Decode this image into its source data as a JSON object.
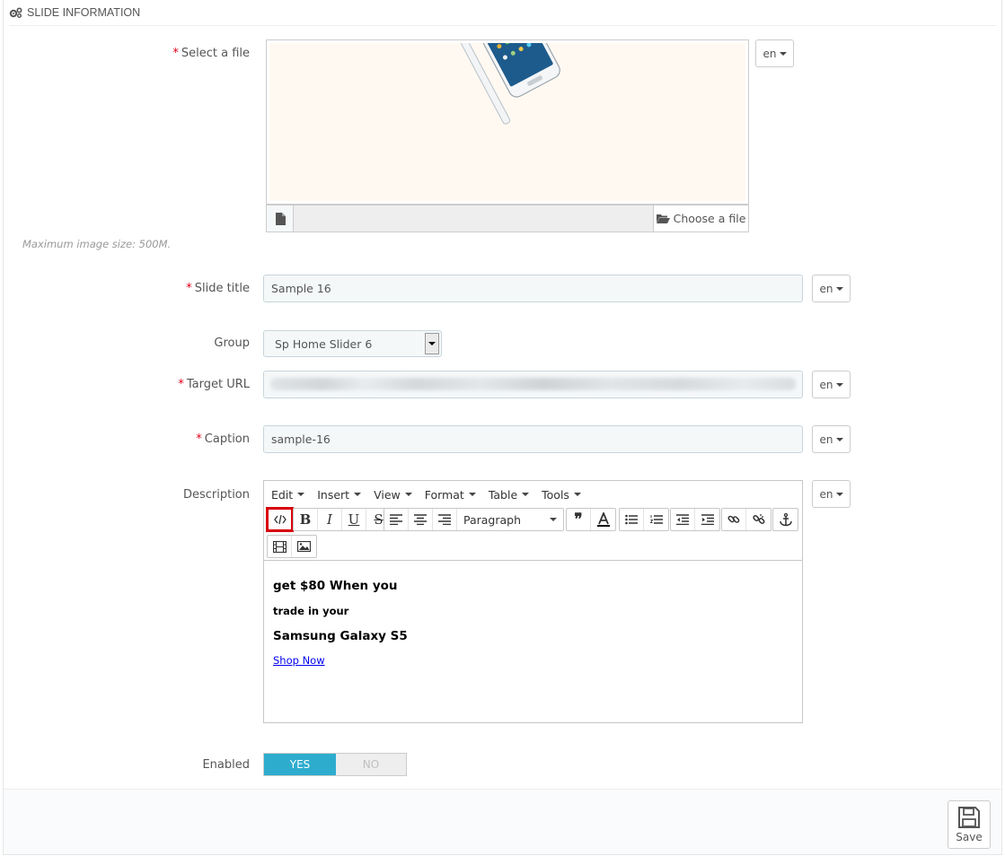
{
  "panel": {
    "title": "SLIDE INFORMATION"
  },
  "file": {
    "label": "Select a file",
    "lang": "en",
    "choose_label": "Choose a file",
    "help": "Maximum image size: 500M."
  },
  "title": {
    "label": "Slide title",
    "value": "Sample 16",
    "lang": "en"
  },
  "group": {
    "label": "Group",
    "value": "Sp Home Slider 6"
  },
  "url": {
    "label": "Target URL",
    "lang": "en"
  },
  "caption": {
    "label": "Caption",
    "value": "sample-16",
    "lang": "en"
  },
  "description": {
    "label": "Description",
    "lang": "en",
    "menus": [
      "Edit",
      "Insert",
      "View",
      "Format",
      "Table",
      "Tools"
    ],
    "block_format": "Paragraph",
    "content": {
      "line1": "get $80 When you",
      "line2": "trade in your",
      "line3": "Samsung Galaxy S5",
      "link": "Shop Now"
    }
  },
  "enabled": {
    "label": "Enabled",
    "yes": "YES",
    "no": "NO"
  },
  "footer": {
    "save": "Save"
  },
  "colors": {
    "required": "#e3001b",
    "toggle_on": "#2eacce",
    "highlight": "#d8000c"
  }
}
